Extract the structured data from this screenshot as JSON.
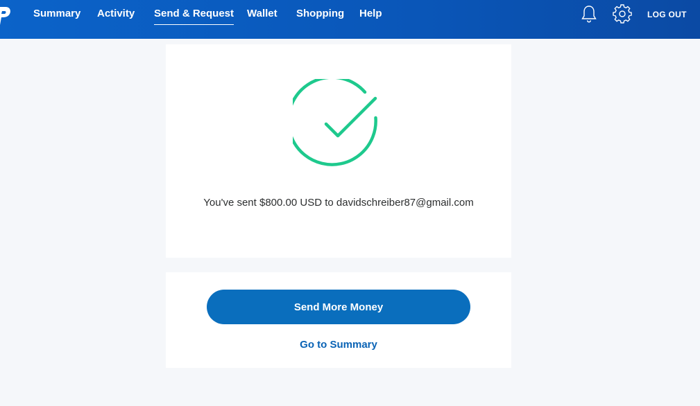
{
  "header": {
    "logo_icon": "paypal-logo-icon",
    "nav": [
      {
        "label": "Summary",
        "active": false
      },
      {
        "label": "Activity",
        "active": false
      },
      {
        "label": "Send & Request",
        "active": true
      },
      {
        "label": "Wallet",
        "active": false
      },
      {
        "label": "Shopping",
        "active": false
      },
      {
        "label": "Help",
        "active": false
      }
    ],
    "icons": [
      "bell-icon",
      "gear-icon"
    ],
    "logout_label": "LOG OUT"
  },
  "confirmation": {
    "icon": "success-check-icon",
    "message": "You've sent $800.00 USD to davidschreiber87@gmail.com"
  },
  "actions": {
    "primary_label": "Send More Money",
    "secondary_label": "Go to Summary"
  },
  "colors": {
    "header": "#0b63c9",
    "background": "#f5f7fa",
    "success": "#1ec98d",
    "button": "#0a6ebd",
    "link": "#0a63b5"
  }
}
